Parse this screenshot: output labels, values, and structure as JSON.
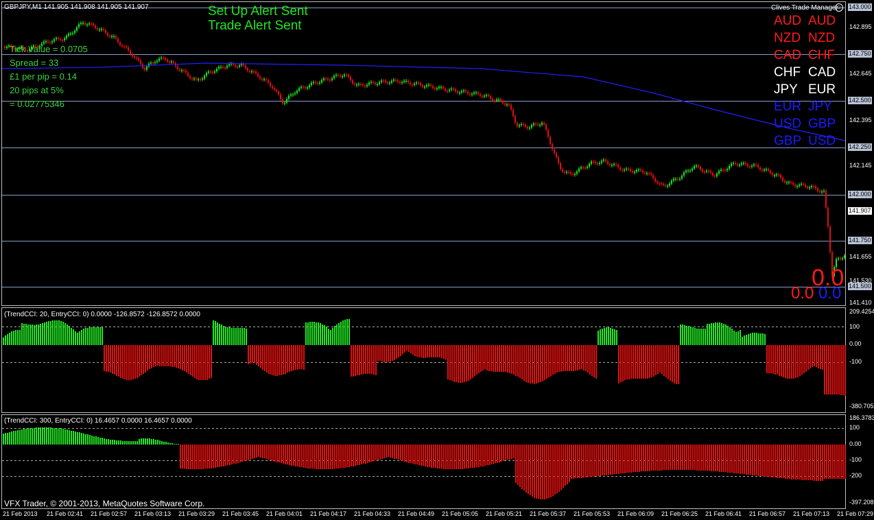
{
  "symbol_header": "GBPJPY,M1  141.905 141.908 141.905 141.907",
  "alerts": {
    "setup": "Set Up Alert Sent",
    "trade": "Trade Alert Sent"
  },
  "info": {
    "tick_value": "Tick Value = 0.0705",
    "spread": "Spread = 33",
    "per_pip": "£1 per pip = 0.14",
    "pips_risk": "20 pips at 5%",
    "lot": "= 0.02775346"
  },
  "manager": {
    "title": "Clives Trade Manager",
    "rows": [
      {
        "left": "AUD",
        "right": "AUD",
        "color": "#ff1a1a"
      },
      {
        "left": "NZD",
        "right": "NZD",
        "color": "#ff1a1a"
      },
      {
        "left": "CAD",
        "right": "CHF",
        "color": "#ff1a1a"
      },
      {
        "left": "CHF",
        "right": "CAD",
        "color": "#ffffff"
      },
      {
        "left": "JPY",
        "right": "EUR",
        "color": "#ffffff"
      },
      {
        "left": "EUR",
        "right": "JPY",
        "color": "#1a1aff"
      },
      {
        "left": "USD",
        "right": "GBP",
        "color": "#1a1aff"
      },
      {
        "left": "GBP",
        "right": "USD",
        "color": "#1a1aff"
      }
    ]
  },
  "price_labels": {
    "boxed": [
      "143.000",
      "142.750",
      "142.500",
      "142.250",
      "142.000",
      "141.750",
      "141.500"
    ],
    "plain": [
      "142.895",
      "142.645",
      "142.395",
      "142.145",
      "141.655",
      "141.530",
      "141.410"
    ],
    "current": "141.907"
  },
  "overlay_numbers": {
    "big_zero": "0.0",
    "red_small": "0.0",
    "blue_small": "0.0"
  },
  "indicator1": {
    "label": "(TrendCCI: 20, EntryCCI: 0)  0.0000 -126.8572 -126.8572 0.0000",
    "axis": [
      "209.4254",
      "100",
      "0.00",
      "-100",
      "-380.705"
    ]
  },
  "indicator2": {
    "label": "(TrendCCI: 300, EntryCCI: 0)  16.4657 0.0000 16.4657 0.0000",
    "axis": [
      "186.3783",
      "100",
      "0.00",
      "-100",
      "-200",
      "-397.2081"
    ]
  },
  "copyright": "VFX Trader, © 2001-2013, MetaQuotes Software Corp.",
  "time_labels": [
    "21 Feb 2013",
    "21 Feb 02:41",
    "21 Feb 02:57",
    "21 Feb 03:13",
    "21 Feb 03:29",
    "21 Feb 03:45",
    "21 Feb 04:01",
    "21 Feb 04:17",
    "21 Feb 04:33",
    "21 Feb 04:49",
    "21 Feb 05:05",
    "21 Feb 05:21",
    "21 Feb 05:37",
    "21 Feb 05:53",
    "21 Feb 06:09",
    "21 Feb 06:25",
    "21 Feb 06:41",
    "21 Feb 06:57",
    "21 Feb 07:13",
    "21 Feb 07:29"
  ],
  "colors": {
    "bull": "#22e622",
    "bear": "#e01010",
    "ma": "#2020ff",
    "grid": "#8c9cc8",
    "panel_border": "#c8c8c8"
  }
}
